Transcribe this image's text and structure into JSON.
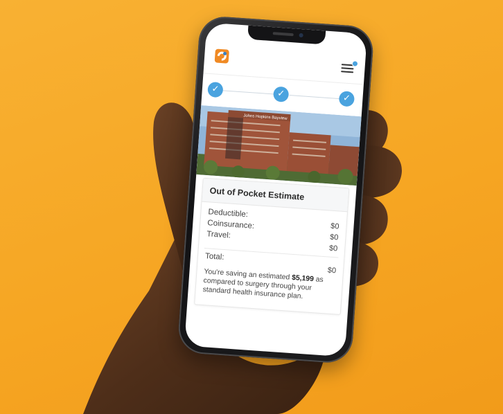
{
  "colors": {
    "background": "#f6a623",
    "accent": "#4aa3df",
    "logo_orange": "#f08a24",
    "logo_blue": "#3a7fc0"
  },
  "header": {
    "logo": "logo-icon",
    "menu": "hamburger-menu-icon"
  },
  "stepper": {
    "steps": [
      {
        "status": "complete",
        "icon": "check-icon",
        "glyph": "✓"
      },
      {
        "status": "complete",
        "icon": "check-icon",
        "glyph": "✓"
      },
      {
        "status": "complete",
        "icon": "check-icon",
        "glyph": "✓"
      }
    ]
  },
  "photo": {
    "sign_text": "Johns Hopkins Bayview"
  },
  "estimate": {
    "title": "Out of Pocket Estimate",
    "rows": [
      {
        "label": "Deductible:",
        "value": "$0"
      },
      {
        "label": "Coinsurance:",
        "value": "$0"
      },
      {
        "label": "Travel:",
        "value": "$0"
      }
    ],
    "total_label": "Total:",
    "total_value": "$0",
    "saving_prefix": "You're saving an estimated ",
    "saving_amount": "$5,199",
    "saving_suffix": " as compared to surgery through your standard health insurance plan."
  }
}
